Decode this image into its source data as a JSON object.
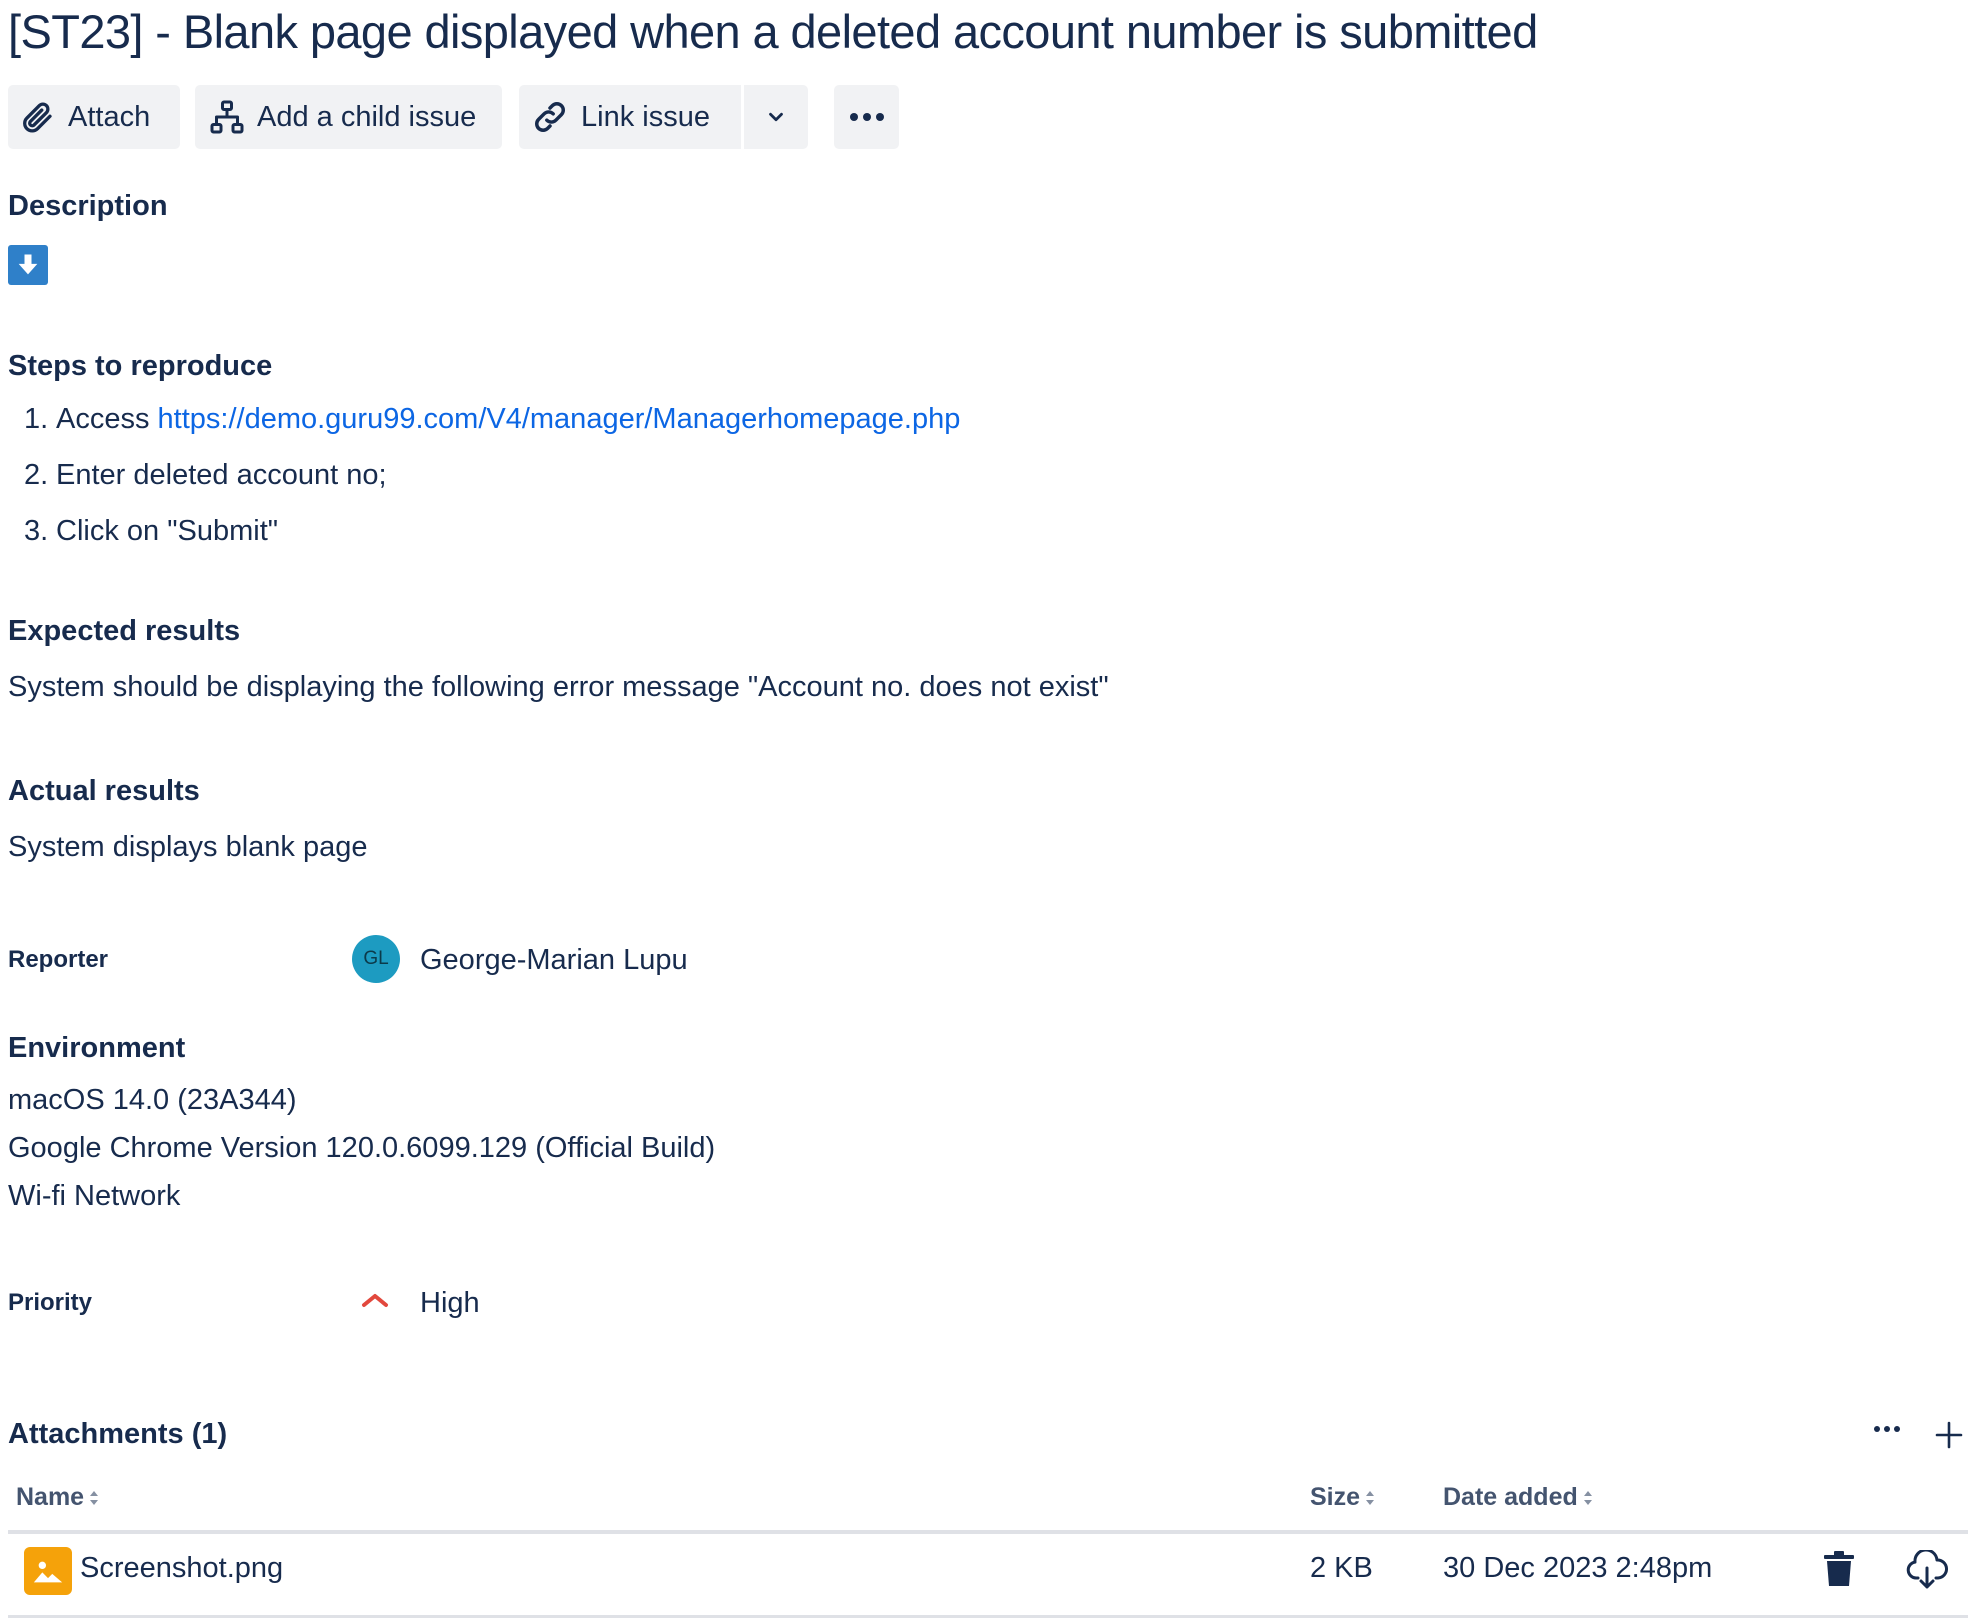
{
  "issue": {
    "title": "[ST23] - Blank page displayed when a deleted account number is submitted"
  },
  "toolbar": {
    "attach_label": "Attach",
    "child_issue_label": "Add a child issue",
    "link_issue_label": "Link issue"
  },
  "description": {
    "heading": "Description",
    "steps_heading": "Steps to reproduce",
    "steps": [
      {
        "num": "1.",
        "prefix": "Access ",
        "link": "https://demo.guru99.com/V4/manager/Managerhomepage.php"
      },
      {
        "num": "2.",
        "text": "Enter deleted account no;"
      },
      {
        "num": "3.",
        "text": "Click on \"Submit\""
      }
    ],
    "expected_heading": "Expected results",
    "expected_text": "System should be displaying the following error message \"Account no. does not exist\"",
    "actual_heading": "Actual results",
    "actual_text": "System displays blank page"
  },
  "reporter": {
    "label": "Reporter",
    "initials": "GL",
    "name": "George-Marian Lupu",
    "avatar_color": "#1d9bc1"
  },
  "environment": {
    "heading": "Environment",
    "lines": [
      "macOS 14.0 (23A344)",
      "Google Chrome Version 120.0.6099.129 (Official Build)",
      "Wi-fi Network"
    ]
  },
  "priority": {
    "label": "Priority",
    "value": "High",
    "icon": "priority-high-icon",
    "color": "#e2483d"
  },
  "attachments": {
    "heading": "Attachments (1)",
    "columns": {
      "name": "Name",
      "size": "Size",
      "date": "Date added"
    },
    "rows": [
      {
        "name": "Screenshot.png",
        "size": "2 KB",
        "date": "30 Dec 2023 2:48pm"
      }
    ]
  },
  "colors": {
    "text": "#172b4d",
    "link": "#0c66e4",
    "button_bg": "#f1f2f4",
    "image_file": "#f5a20a"
  }
}
